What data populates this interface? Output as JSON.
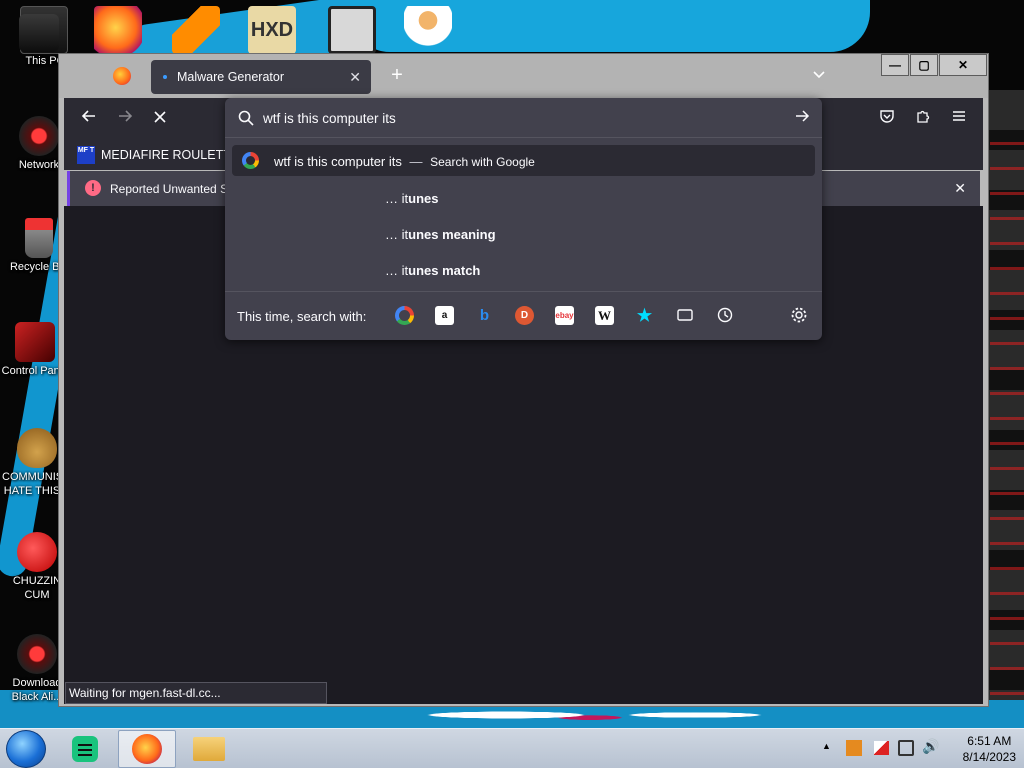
{
  "desktop": {
    "icons": [
      {
        "label": "This PC"
      },
      {
        "label": "Network"
      },
      {
        "label": "Recycle Bin"
      },
      {
        "label": "Control Panel"
      },
      {
        "label": "COMMUNISTS HATE THIS"
      },
      {
        "label": "CHUZZIN CUM"
      },
      {
        "label": "Download Black Ali..."
      }
    ]
  },
  "browser": {
    "tab_title": "Malware Generator",
    "new_tab": "+",
    "bookmark_label": "MEDIAFIRE ROULETTER",
    "bookmark_icon_text": "MF T",
    "notification": "Reported Unwanted Software Page!",
    "status": "Waiting for mgen.fast-dl.cc...",
    "window_buttons": {
      "minimize": "—",
      "maximize": "▢",
      "close": "✕"
    }
  },
  "urlbar": {
    "value": "wtf is this computer its",
    "selected_row": {
      "query": "wtf is this computer its",
      "separator": "—",
      "action": "Search with Google"
    },
    "suggestions": [
      {
        "prefix": "… it",
        "bold": "unes"
      },
      {
        "prefix": "… it",
        "bold": "unes meaning"
      },
      {
        "prefix": "… it",
        "bold": "unes match"
      }
    ],
    "engine_label": "This time, search with:",
    "engines": [
      "google-icon",
      "amazon-icon",
      "bing-icon",
      "duckduckgo-icon",
      "ebay-icon",
      "wikipedia-icon",
      "bookmarks-star-icon",
      "tabs-icon",
      "history-icon"
    ]
  },
  "taskbar": {
    "time": "6:51 AM",
    "date": "8/14/2023"
  },
  "colors": {
    "toolbar": "#2b2a33",
    "dropdown": "#42414d",
    "content": "#1c1b22",
    "accent": "#7542e5"
  }
}
